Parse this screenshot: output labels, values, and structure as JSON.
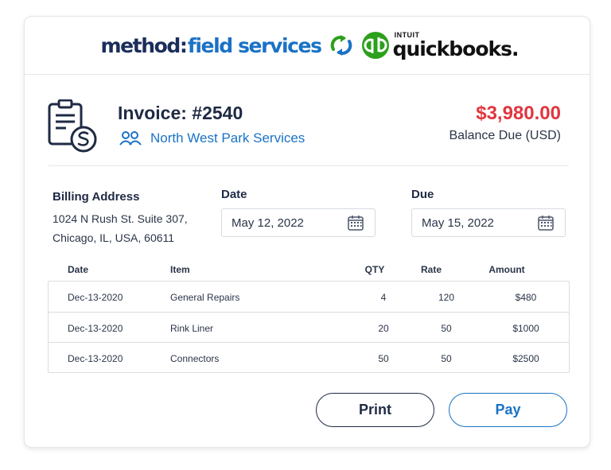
{
  "header": {
    "logo_method": "method",
    "logo_colon": ":",
    "logo_field": "field services",
    "qb_intuit": "INTUIT",
    "qb_name": "quickbooks."
  },
  "invoice": {
    "title": "Invoice: #2540",
    "customer": "North West Park Services",
    "balance_amount": "$3,980.00",
    "balance_label": "Balance Due (USD)"
  },
  "billing": {
    "label": "Billing Address",
    "line1": "1024 N Rush St. Suite 307,",
    "line2": "Chicago, IL, USA, 60611"
  },
  "dates": {
    "date_label": "Date",
    "date_value": "May 12, 2022",
    "due_label": "Due",
    "due_value": "May 15, 2022"
  },
  "table": {
    "headers": [
      "Date",
      "Item",
      "QTY",
      "Rate",
      "Amount"
    ],
    "rows": [
      [
        "Dec-13-2020",
        "General Repairs",
        "4",
        "120",
        "$480"
      ],
      [
        "Dec-13-2020",
        "Rink Liner",
        "20",
        "50",
        "$1000"
      ],
      [
        "Dec-13-2020",
        "Connectors",
        "50",
        "50",
        "$2500"
      ]
    ]
  },
  "actions": {
    "print_label": "Print",
    "pay_label": "Pay"
  },
  "colors": {
    "navy": "#1b2d5b",
    "brand_blue": "#1a72c6",
    "quickbooks_green": "#2ca01c",
    "balance_red": "#e0363f"
  },
  "icons": [
    "sync-icon",
    "quickbooks-icon",
    "invoice-dollar-icon",
    "people-icon",
    "calendar-icon"
  ]
}
